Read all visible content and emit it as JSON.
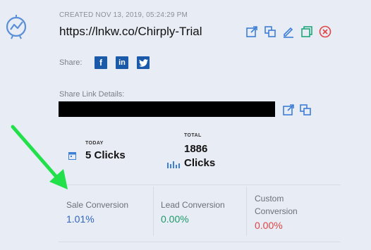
{
  "header": {
    "created": "CREATED NOV 13, 2019, 05:24:29 PM",
    "url": "https://lnkw.co/Chirply-Trial"
  },
  "actions": [
    {
      "name": "open-external-icon",
      "color": "#3d7fd6"
    },
    {
      "name": "copy-icon",
      "color": "#3d7fd6"
    },
    {
      "name": "edit-icon",
      "color": "#3d7fd6"
    },
    {
      "name": "duplicate-icon",
      "color": "#1fa67a"
    },
    {
      "name": "delete-icon",
      "color": "#e04545"
    }
  ],
  "share": {
    "label": "Share:",
    "networks": [
      "f",
      "in",
      "twitter"
    ]
  },
  "share_link": {
    "label": "Share Link Details:"
  },
  "stats": {
    "today_caption": "TODAY",
    "today_value": "5 Clicks",
    "total_caption": "TOTAL",
    "total_value_line1": "1886",
    "total_value_line2": "Clicks"
  },
  "conversions": [
    {
      "label": "Sale Conversion",
      "value": "1.01%",
      "color": "#2f64c4"
    },
    {
      "label": "Lead Conversion",
      "value": "0.00%",
      "color": "#1a9a6a"
    },
    {
      "label": "Custom Conversion",
      "value": "0.00%",
      "color": "#e04545"
    }
  ]
}
